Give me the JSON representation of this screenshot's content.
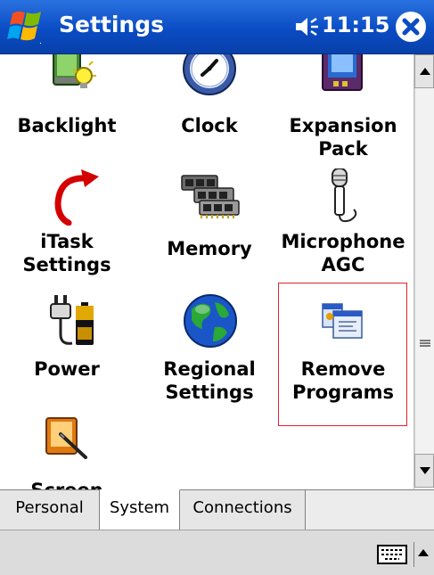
{
  "title_bar": {
    "title": "Settings",
    "time": "11:15",
    "icons": [
      "windows-flag-icon",
      "speaker-icon",
      "close-icon"
    ]
  },
  "items": [
    {
      "id": "backlight",
      "lines": [
        "Backlight"
      ],
      "icon": "backlight-icon"
    },
    {
      "id": "clock",
      "lines": [
        "Clock"
      ],
      "icon": "clock-icon"
    },
    {
      "id": "expansion-pack",
      "lines": [
        "Expansion",
        "Pack"
      ],
      "icon": "expansion-pack-icon"
    },
    {
      "id": "itask-settings",
      "lines": [
        "iTask",
        "Settings"
      ],
      "icon": "itask-arrow-icon"
    },
    {
      "id": "memory",
      "lines": [
        "Memory"
      ],
      "icon": "memory-chips-icon"
    },
    {
      "id": "microphone-agc",
      "lines": [
        "Microphone",
        "AGC"
      ],
      "icon": "microphone-icon"
    },
    {
      "id": "power",
      "lines": [
        "Power"
      ],
      "icon": "power-battery-icon"
    },
    {
      "id": "regional-settings",
      "lines": [
        "Regional",
        "Settings"
      ],
      "icon": "globe-icon"
    },
    {
      "id": "remove-programs",
      "lines": [
        "Remove",
        "Programs"
      ],
      "icon": "remove-programs-icon",
      "selected": true
    },
    {
      "id": "screen",
      "lines": [
        "Screen"
      ],
      "icon": "screen-stylus-icon"
    }
  ],
  "tabs": [
    {
      "label": "Personal",
      "active": false
    },
    {
      "label": "System",
      "active": true
    },
    {
      "label": "Connections",
      "active": false
    }
  ],
  "command_bar": {
    "icons": [
      "keyboard-icon",
      "chevron-up-icon"
    ]
  },
  "colors": {
    "title_bar": "#0a4cc4",
    "selection_border": "#e0242b"
  }
}
